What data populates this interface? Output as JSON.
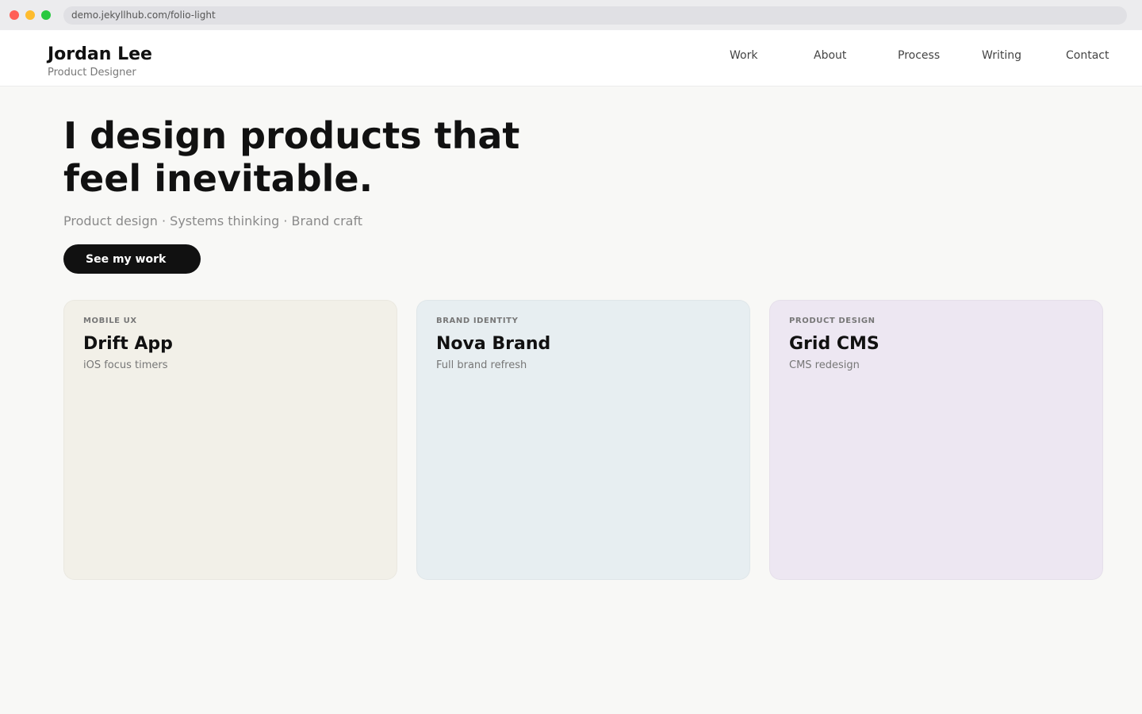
{
  "browser": {
    "url": "demo.jekyllhub.com/folio-light"
  },
  "header": {
    "name": "Jordan Lee",
    "tagline": "Product Designer",
    "nav": [
      {
        "label": "Work"
      },
      {
        "label": "About"
      },
      {
        "label": "Process"
      },
      {
        "label": "Writing"
      },
      {
        "label": "Contact"
      }
    ]
  },
  "hero": {
    "title_line1": "I design products that",
    "title_line2": "feel inevitable.",
    "subtitle": "Product design · Systems thinking · Brand craft",
    "cta_label": "See my work"
  },
  "projects": [
    {
      "kicker": "MOBILE UX",
      "title": "Drift App",
      "description": "iOS focus timers",
      "color": "#f2f0e8"
    },
    {
      "kicker": "BRAND IDENTITY",
      "title": "Nova Brand",
      "description": "Full brand refresh",
      "color": "#e7eef1"
    },
    {
      "kicker": "PRODUCT DESIGN",
      "title": "Grid CMS",
      "description": "CMS redesign",
      "color": "#ede7f2"
    }
  ],
  "colors": {
    "page_background": "#f8f8f6",
    "cta_background": "#111111",
    "traffic_red": "#ff5f57",
    "traffic_yellow": "#febc2e",
    "traffic_green": "#28c840"
  }
}
